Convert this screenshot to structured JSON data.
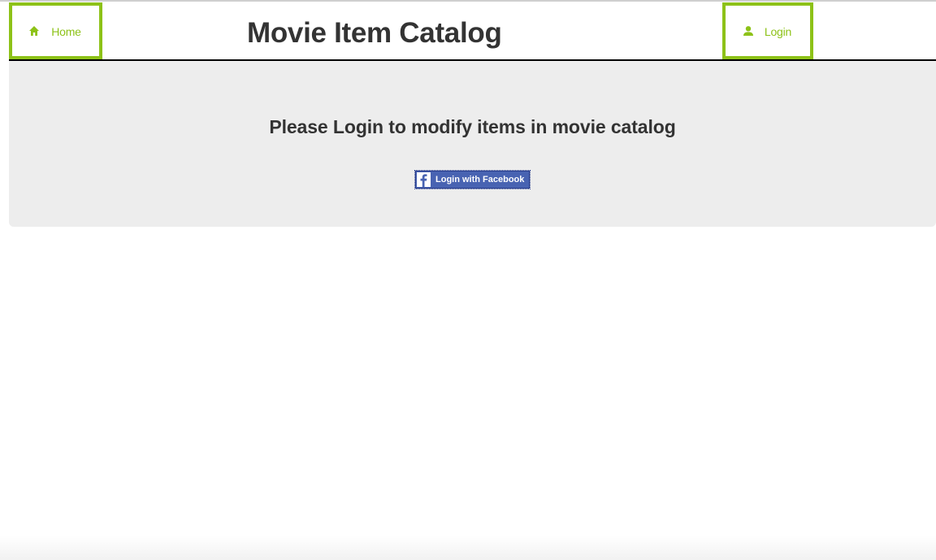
{
  "header": {
    "title": "Movie Item Catalog",
    "nav": {
      "home_label": "Home",
      "home_icon": "home-icon",
      "login_label": "Login",
      "login_icon": "user-icon"
    },
    "accent_color": "#8dc218"
  },
  "main": {
    "message": "Please Login to modify items in movie catalog",
    "facebook_button": {
      "label": "Login with Facebook",
      "icon": "facebook-icon",
      "color": "#4863b2"
    },
    "panel_color": "#ededed"
  }
}
